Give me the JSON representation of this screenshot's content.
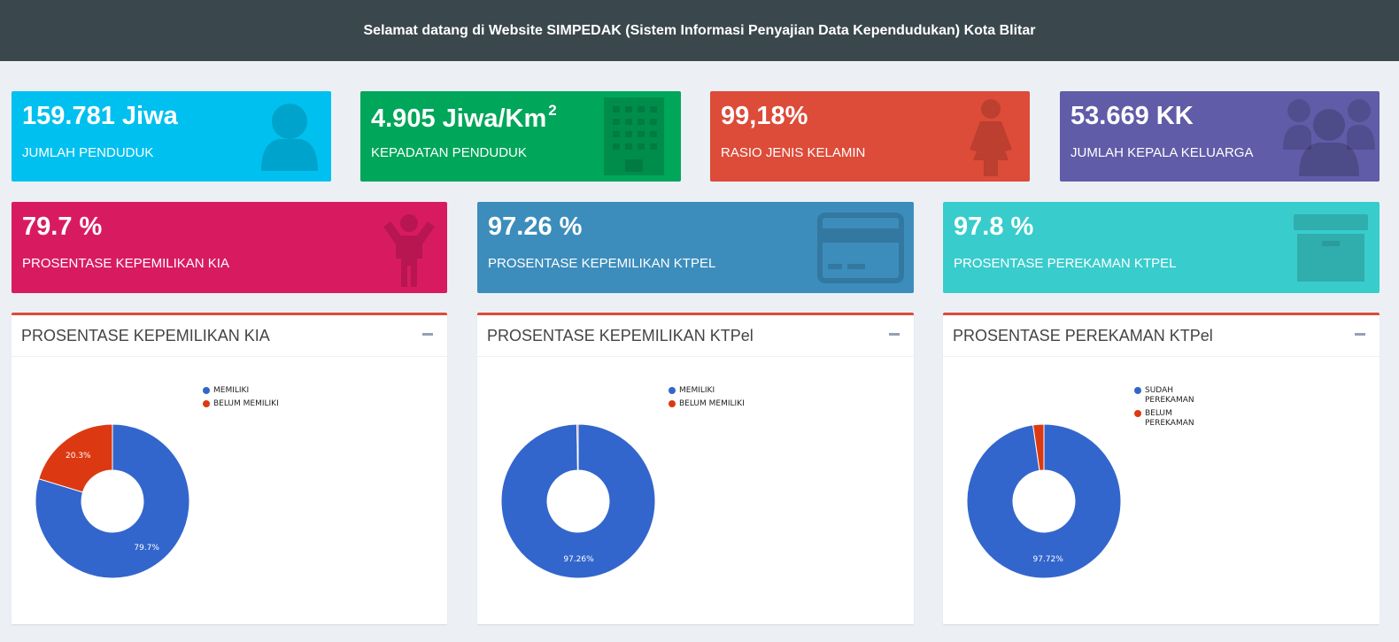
{
  "header": {
    "title": "Selamat datang di Website SIMPEDAK (Sistem Informasi Penyajian Data Kependudukan) Kota Blitar"
  },
  "stats_row1": [
    {
      "value": "159.781 Jiwa",
      "label": "JUMLAH PENDUDUK",
      "color": "#00c0ef",
      "icon": "user-icon"
    },
    {
      "value": "4.905 Jiwa/Km",
      "value_sup": "2",
      "label": "KEPADATAN PENDUDUK",
      "color": "#00a65a",
      "icon": "building-icon"
    },
    {
      "value": "99,18%",
      "label": "RASIO JENIS KELAMIN",
      "color": "#dd4b39",
      "icon": "female-icon"
    },
    {
      "value": "53.669 KK",
      "label": "JUMLAH KEPALA KELUARGA",
      "color": "#605ca8",
      "icon": "users-icon"
    }
  ],
  "stats_row2": [
    {
      "value": "79.7 %",
      "label": "PROSENTASE KEPEMILIKAN KIA",
      "color": "#d81b60",
      "icon": "child-icon"
    },
    {
      "value": "97.26 %",
      "label": "PROSENTASE KEPEMILIKAN KTPel",
      "color": "#3c8dbc",
      "icon": "credit-card-icon"
    },
    {
      "value": "97.8 %",
      "label": "PROSENTASE PEREKAMAN KTPel",
      "color": "#39cccc",
      "icon": "archive-icon"
    }
  ],
  "colors": {
    "blue": "#3366cc",
    "red": "#dc3912",
    "panel_border": "#dd4b39"
  },
  "chart_data": [
    {
      "type": "pie",
      "title": "PROSENTASE KEPEMILIKAN KIA",
      "categories": [
        "MEMILIKI",
        "BELUM MEMILIKI"
      ],
      "values": [
        79.7,
        20.3
      ],
      "labels": [
        "79.7%",
        "20.3%"
      ],
      "donut": true,
      "legend": "top-right"
    },
    {
      "type": "pie",
      "title": "PROSENTASE KEPEMILIKAN KTPel",
      "categories": [
        "MEMILIKI",
        "BELUM MEMILIKI"
      ],
      "values": [
        99.74,
        0.26
      ],
      "labels": [
        "97.26%",
        ""
      ],
      "donut": true,
      "legend": "top-right"
    },
    {
      "type": "pie",
      "title": "PROSENTASE PEREKAMAN KTPel",
      "categories": [
        "SUDAH PEREKAMAN",
        "BELUM PEREKAMAN"
      ],
      "values": [
        97.72,
        2.28
      ],
      "labels": [
        "97.72%",
        ""
      ],
      "donut": true,
      "legend": "top-right"
    }
  ]
}
